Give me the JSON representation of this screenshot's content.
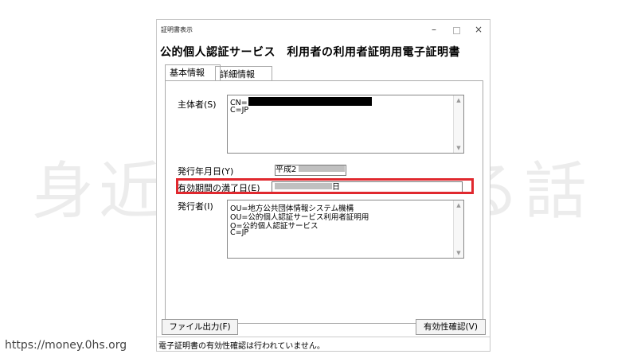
{
  "watermark": "身近な    で得する話",
  "url": "https://money.0hs.org",
  "window": {
    "title": "証明書表示",
    "controls": {
      "minimize": "–",
      "close": "×"
    },
    "heading": "公的個人認証サービス　利用者の利用者証明用電子証明書",
    "tabs": [
      {
        "label": "基本情報"
      },
      {
        "label": "詳細情報"
      }
    ],
    "subject": {
      "label": "主体者(S)",
      "lines": [
        "CN=",
        "C=JP"
      ]
    },
    "issue_date": {
      "label": "発行年月日(Y)",
      "value": "平成2"
    },
    "expiry_date": {
      "label": "有効期間の満了日(E)",
      "value_suffix": "日"
    },
    "issuer": {
      "label": "発行者(I)",
      "lines": [
        "OU=地方公共団体情報システム機構",
        "OU=公的個人認証サービス利用者証明用",
        "O=公的個人認証サービス",
        "C=JP"
      ]
    },
    "buttons": {
      "export": "ファイル出力(F)",
      "validate": "有効性確認(V)"
    },
    "status": "電子証明書の有効性確認は行われていません。"
  },
  "colors": {
    "highlight": "#e0282e"
  }
}
